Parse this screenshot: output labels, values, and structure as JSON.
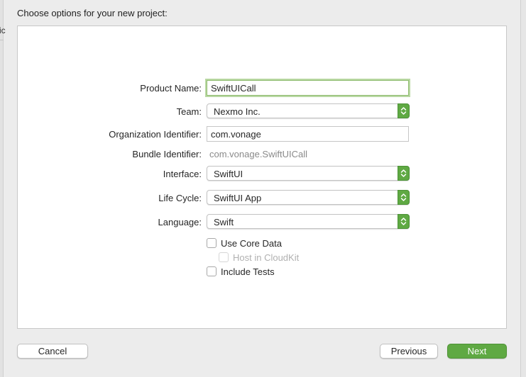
{
  "sheet": {
    "title": "Choose options for your new project:",
    "left_fragment": "ic"
  },
  "form": {
    "product_name": {
      "label": "Product Name:",
      "value": "SwiftUICall"
    },
    "team": {
      "label": "Team:",
      "value": "Nexmo Inc."
    },
    "organization_identifier": {
      "label": "Organization Identifier:",
      "value": "com.vonage"
    },
    "bundle_identifier": {
      "label": "Bundle Identifier:",
      "value": "com.vonage.SwiftUICall"
    },
    "interface": {
      "label": "Interface:",
      "value": "SwiftUI"
    },
    "life_cycle": {
      "label": "Life Cycle:",
      "value": "SwiftUI App"
    },
    "language": {
      "label": "Language:",
      "value": "Swift"
    },
    "use_core_data": {
      "label": "Use Core Data",
      "checked": false
    },
    "host_in_cloudkit": {
      "label": "Host in CloudKit",
      "checked": false,
      "enabled": false
    },
    "include_tests": {
      "label": "Include Tests",
      "checked": false
    }
  },
  "buttons": {
    "cancel": "Cancel",
    "previous": "Previous",
    "next": "Next"
  },
  "colors": {
    "accent": "#5fa943",
    "focus_ring": "#b9d8a3"
  },
  "icons": {
    "popup_stepper": "up-down-chevron-icon"
  }
}
